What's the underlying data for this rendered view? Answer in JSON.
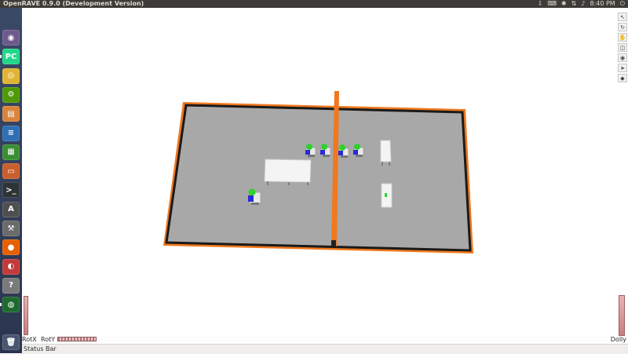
{
  "window": {
    "title": "OpenRAVE 0.9.0 (Development Version)"
  },
  "system_tray": {
    "clock": "8:40 PM",
    "icons": [
      "dropbox-icon",
      "keyboard-icon",
      "bluetooth-icon",
      "network-icon",
      "volume-icon",
      "power-icon"
    ]
  },
  "launcher": {
    "items": [
      {
        "name": "ubuntu-dash",
        "glyph": "◉",
        "color": "#6e5a8c",
        "active": false
      },
      {
        "name": "pycharm",
        "glyph": "PC",
        "color": "#21d789",
        "active": true
      },
      {
        "name": "chrome",
        "glyph": "◎",
        "color": "#e0b433",
        "active": false
      },
      {
        "name": "settings",
        "glyph": "⚙",
        "color": "#4e9a06",
        "active": false
      },
      {
        "name": "files",
        "glyph": "▤",
        "color": "#d9833b",
        "active": false
      },
      {
        "name": "writer",
        "glyph": "≡",
        "color": "#2f6fb3",
        "active": false
      },
      {
        "name": "calc",
        "glyph": "▦",
        "color": "#3b8e33",
        "active": false
      },
      {
        "name": "impress",
        "glyph": "▭",
        "color": "#c85f2e",
        "active": false
      },
      {
        "name": "terminal",
        "glyph": ">_",
        "color": "#2e3436",
        "active": false
      },
      {
        "name": "software",
        "glyph": "A",
        "color": "#4f4f4f",
        "active": false
      },
      {
        "name": "system-settings",
        "glyph": "⚒",
        "color": "#6b6b6b",
        "active": false
      },
      {
        "name": "firefox",
        "glyph": "●",
        "color": "#e66000",
        "active": false
      },
      {
        "name": "image-viewer",
        "glyph": "◐",
        "color": "#c33a3a",
        "active": false
      },
      {
        "name": "help",
        "glyph": "?",
        "color": "#7a7a7a",
        "active": false
      },
      {
        "name": "openrave",
        "glyph": "◍",
        "color": "#1e6b2f",
        "active": true
      }
    ],
    "trash_glyph": "🗑"
  },
  "right_toolbar": {
    "tools": [
      {
        "name": "pointer-tool",
        "glyph": "↖"
      },
      {
        "name": "rotate-tool",
        "glyph": "↻"
      },
      {
        "name": "pick-tool",
        "glyph": "✋"
      },
      {
        "name": "view-tool",
        "glyph": "◫"
      },
      {
        "name": "camera-tool",
        "glyph": "◉"
      },
      {
        "name": "seek-tool",
        "glyph": "➤"
      },
      {
        "name": "perspective-tool",
        "glyph": "◆"
      }
    ]
  },
  "controls": {
    "rotx_label": "RotX",
    "roty_label": "RotY",
    "dolly_label": "Dolly"
  },
  "status_bar": {
    "text": "Status Bar"
  },
  "colors": {
    "wall_orange": "#f0781e",
    "floor_gray": "#a8a8a8",
    "floor_edge": "#1a1a1a",
    "table_white": "#f4f4f4",
    "robot_green": "#2ed12e",
    "robot_blue": "#2a2ad8"
  }
}
